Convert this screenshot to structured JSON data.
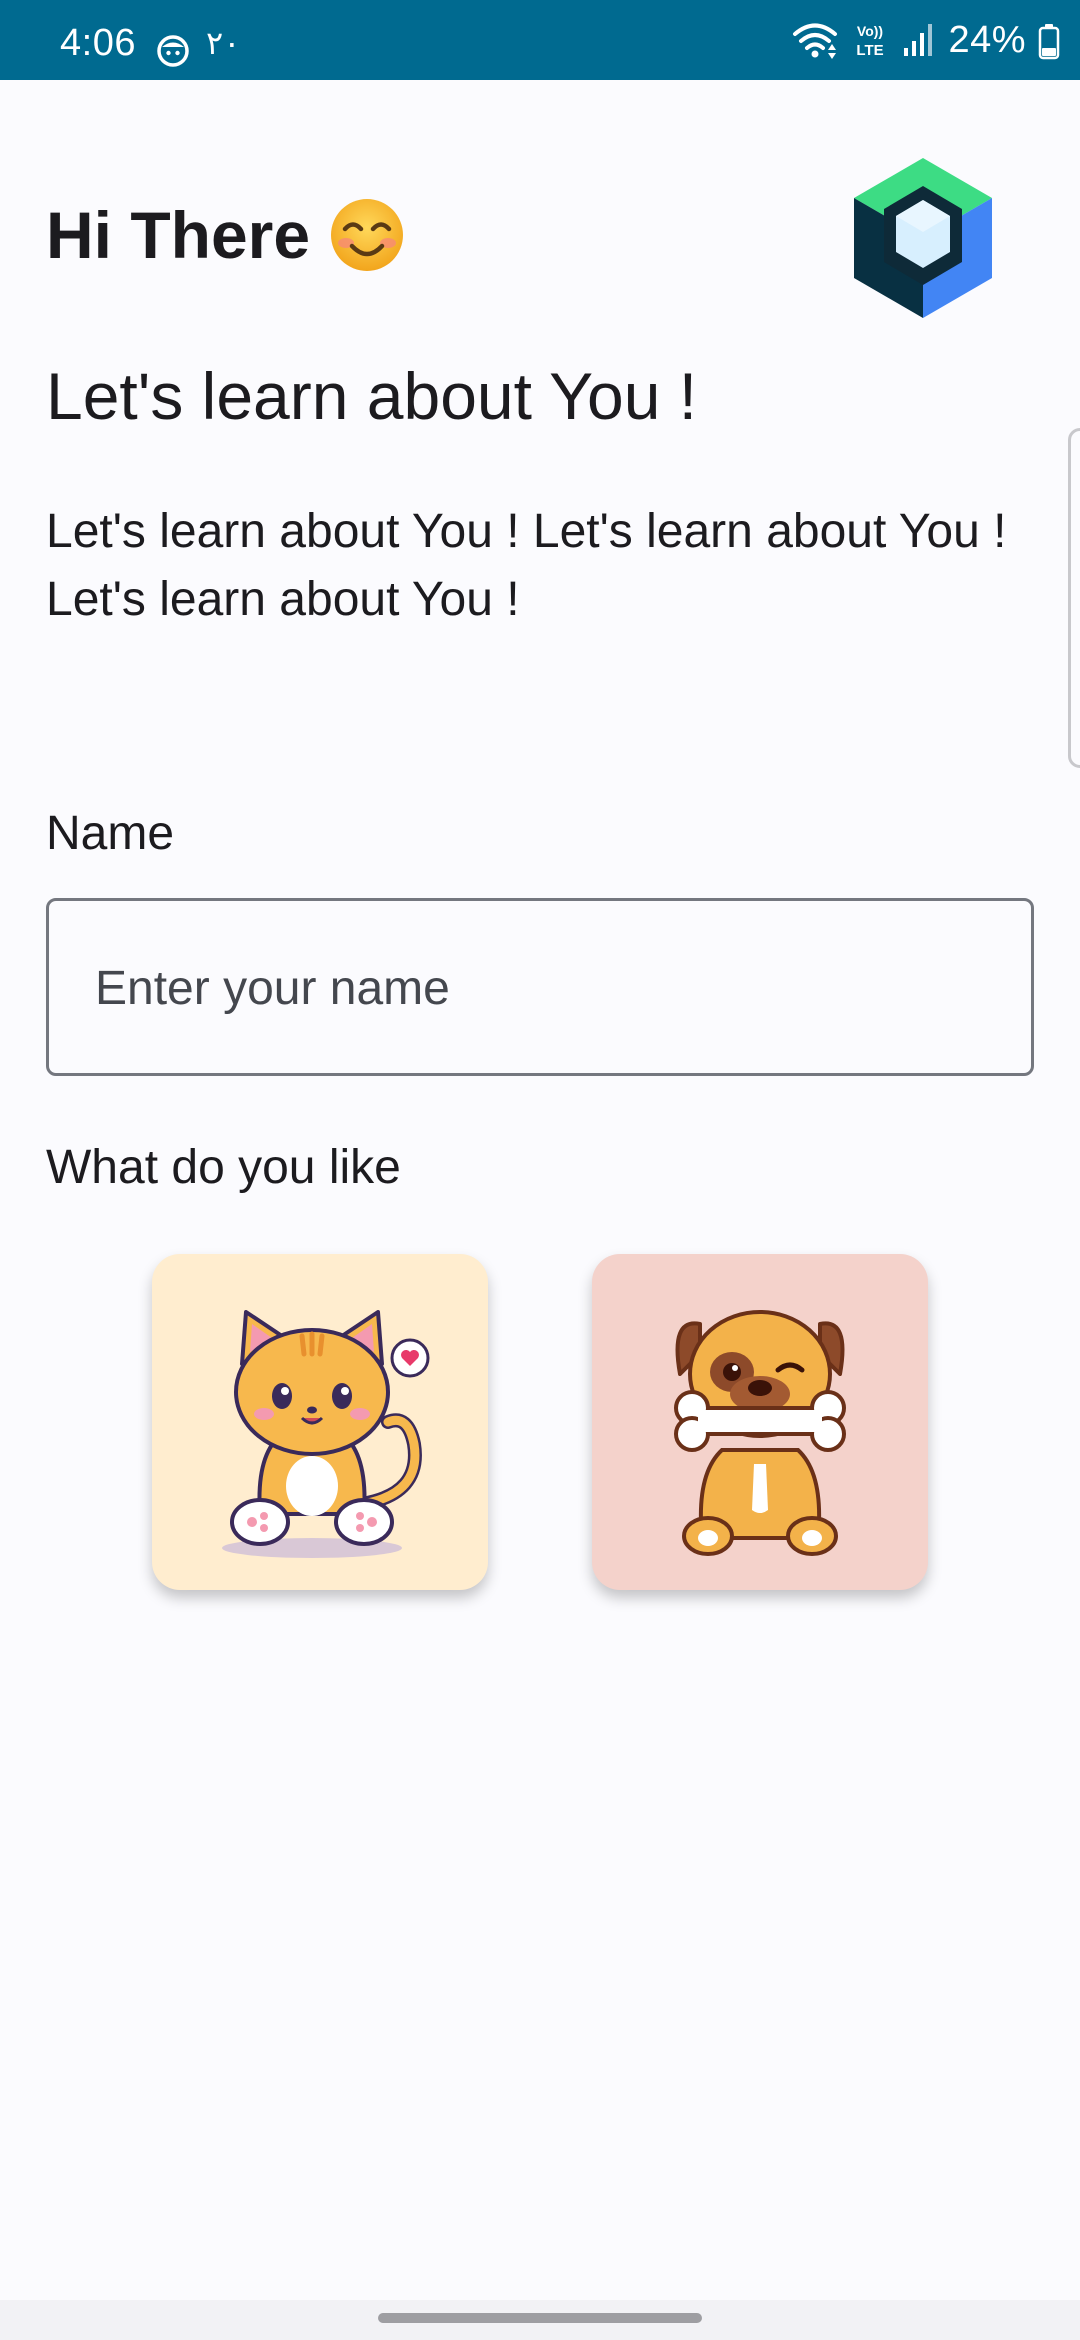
{
  "status_bar": {
    "time": "4:06",
    "notification_count": "٢٠",
    "battery_percent": "24%",
    "icons": [
      "notification-face-icon",
      "wifi-icon",
      "volte-icon",
      "signal-icon",
      "battery-icon"
    ]
  },
  "header": {
    "greeting": "Hi There",
    "emoji": "smiling-face-emoji"
  },
  "content": {
    "headline": "Let's learn about You !",
    "body": "Let's learn about You ! Let's learn about You ! Let's learn about You !"
  },
  "form": {
    "name_label": "Name",
    "name_placeholder": "Enter your name",
    "name_value": "",
    "likes_label": "What do you like",
    "options": [
      {
        "name": "cat",
        "background": "#ffedcf"
      },
      {
        "name": "dog",
        "background": "#f4d2cb"
      }
    ]
  },
  "colors": {
    "status_bar": "#006a90",
    "background": "#fbfbfe",
    "outline": "#74777f"
  }
}
